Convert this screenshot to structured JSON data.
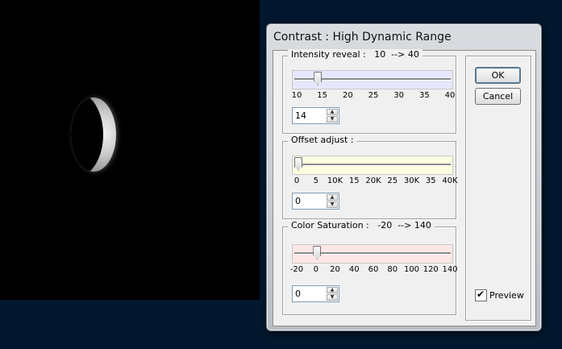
{
  "dialog": {
    "title": "Contrast : High Dynamic Range"
  },
  "intensity": {
    "title": "Intensity reveal :   10  --> 40",
    "ticks": [
      "10",
      "15",
      "20",
      "25",
      "30",
      "35",
      "40"
    ],
    "value": "14",
    "slider_fraction": 0.13,
    "color": "#e6e6ff"
  },
  "offset": {
    "title": "Offset adjust :",
    "ticks": [
      "0",
      "5",
      "10K",
      "15",
      "20K",
      "25",
      "30K",
      "35",
      "40K"
    ],
    "value": "0",
    "slider_fraction": 0.0,
    "color": "#fdfde0"
  },
  "saturation": {
    "title": "Color Saturation :   -20  --> 140",
    "ticks": [
      "-20",
      "0",
      "20",
      "40",
      "60",
      "80",
      "100",
      "120",
      "140"
    ],
    "value": "0",
    "slider_fraction": 0.125,
    "color": "#fde6e6"
  },
  "buttons": {
    "ok": "OK",
    "cancel": "Cancel"
  },
  "preview": {
    "label": "Preview",
    "checked": true
  }
}
